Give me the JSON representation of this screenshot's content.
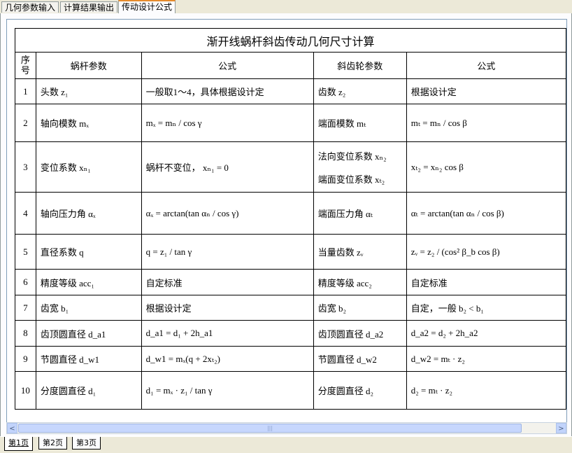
{
  "tabs": [
    {
      "label": "几何参数输入"
    },
    {
      "label": "计算结果输出"
    },
    {
      "label": "传动设计公式"
    }
  ],
  "table": {
    "title": "渐开线蜗杆斜齿传动几何尺寸计算",
    "headers": {
      "seq_top": "序",
      "seq_bottom": "号",
      "worm_param": "蜗杆参数",
      "formula1": "公式",
      "gear_param": "斜齿轮参数",
      "formula2": "公式"
    },
    "rows": [
      {
        "no": "1",
        "worm": "头数 z₁",
        "f1": "一般取1～4，具体根据设计定",
        "gear": "齿数 z₂",
        "f2": "根据设计定"
      },
      {
        "no": "2",
        "worm": "轴向模数 mₓ",
        "f1": "mₓ = mₙ / cos γ",
        "gear": "端面模数 mₜ",
        "f2": "mₜ = mₙ / cos β"
      },
      {
        "no": "3",
        "worm": "变位系数 xₙ₁",
        "f1": "蜗杆不变位， xₙ₁ = 0",
        "gear": "法向变位系数 xₙ₂",
        "gear2": "端面变位系数 xₜ₂",
        "f2": "xₜ₂ = xₙ₂ cos β"
      },
      {
        "no": "4",
        "worm": "轴向压力角 αₓ",
        "f1": "αₓ = arctan(tan αₙ / cos γ)",
        "gear": "端面压力角 αₜ",
        "f2": "αₜ = arctan(tan αₙ / cos β)"
      },
      {
        "no": "5",
        "worm": "直径系数 q",
        "f1": "q = z₁ / tan γ",
        "gear": "当量齿数 zᵥ",
        "f2": "zᵥ = z₂ / (cos² β_b cos β)"
      },
      {
        "no": "6",
        "worm": "精度等级 acc₁",
        "f1": "自定标准",
        "gear": "精度等级 acc₂",
        "f2": "自定标准"
      },
      {
        "no": "7",
        "worm": "齿宽 b₁",
        "f1": "根据设计定",
        "gear": "齿宽 b₂",
        "f2": "自定，一般 b₂ < b₁"
      },
      {
        "no": "8",
        "worm": "齿顶圆直径 d_a1",
        "f1": "d_a1 = d₁ + 2h_a1",
        "gear": "齿顶圆直径 d_a2",
        "f2": "d_a2 = d₂ + 2h_a2"
      },
      {
        "no": "9",
        "worm": "节圆直径 d_w1",
        "f1": "d_w1 = mₓ(q + 2xₜ₂)",
        "gear": "节圆直径 d_w2",
        "f2": "d_w2 = mₜ · z₂"
      },
      {
        "no": "10",
        "worm": "分度圆直径 d₁",
        "f1": "d₁ = mₓ · z₁ / tan γ",
        "gear": "分度圆直径 d₂",
        "f2": "d₂ = mₜ · z₂"
      }
    ]
  },
  "scrollbar": {
    "left_arrow": "<",
    "right_arrow": ">",
    "grip": "|||"
  },
  "sheets": [
    {
      "label": "第1页"
    },
    {
      "label": "第2页"
    },
    {
      "label": "第3页"
    }
  ]
}
